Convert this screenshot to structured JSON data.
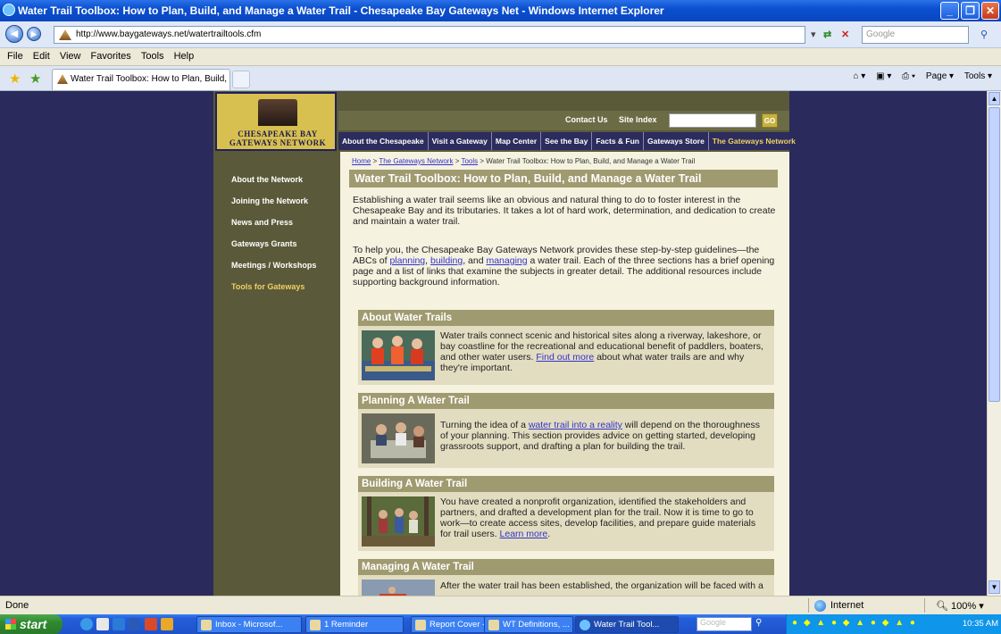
{
  "window": {
    "title": "Water Trail Toolbox: How to Plan, Build, and Manage a Water Trail - Chesapeake Bay Gateways Net - Windows Internet Explorer",
    "min": "_",
    "max": "❐",
    "close": "✕"
  },
  "address_bar": {
    "url": "http://www.baygateways.net/watertrailtools.cfm",
    "search_placeholder": "Google"
  },
  "menu": [
    "File",
    "Edit",
    "View",
    "Favorites",
    "Tools",
    "Help"
  ],
  "tab": {
    "label": "Water Trail Toolbox: How to Plan, Build, a..."
  },
  "command_bar": [
    "Page ▾",
    "Tools ▾"
  ],
  "site": {
    "logo_line1": "CHESAPEAKE BAY",
    "logo_line2": "GATEWAYS NETWORK",
    "top_links": [
      "Contact Us",
      "Site Index"
    ],
    "go_label": "GO",
    "nav": [
      "About the Chesapeake",
      "Visit a Gateway",
      "Map Center",
      "See the Bay",
      "Facts & Fun",
      "Gateways Store",
      "The Gateways Network"
    ],
    "sidebar": [
      "About the Network",
      "Joining the Network",
      "News and Press",
      "Gateways Grants",
      "Meetings / Workshops",
      "Tools for Gateways"
    ],
    "breadcrumb": {
      "home": "Home",
      "sep1": " > ",
      "network": "The Gateways Network",
      "sep2": " > ",
      "tools": "Tools",
      "current": " > Water Trail Toolbox: How to Plan, Build, and Manage a Water Trail"
    },
    "page_title": "Water Trail Toolbox: How to Plan, Build, and Manage a Water Trail",
    "intro1": "Establishing a water trail seems like an obvious and natural thing to do to foster interest in the Chesapeake Bay and its tributaries. It takes a lot of hard work, determination, and dedication to create and maintain a water trail.",
    "intro2_a": "To help you, the Chesapeake Bay Gateways Network provides these step-by-step guidelines—the ABCs of ",
    "intro2_planning": "planning",
    "intro2_comma": ", ",
    "intro2_building": "building",
    "intro2_and": ", and ",
    "intro2_managing": "managing",
    "intro2_b": " a water trail. Each of the three sections has a brief opening page and a list of links that examine the subjects in greater detail. The additional resources include supporting background information.",
    "sections": [
      {
        "title": "About Water Trails",
        "text_a": "Water trails connect scenic and historical sites along a riverway, lakeshore, or bay coastline for the recreational and educational benefit of paddlers, boaters, and other water users. ",
        "link": "Find out more",
        "text_b": " about what water trails are and why they're important."
      },
      {
        "title": "Planning A Water Trail",
        "text_a": "Turning the idea of a ",
        "link": "water trail into a reality",
        "text_b": " will depend on the thoroughness of your planning. This section provides advice on getting started, developing grassroots support, and drafting a plan for building the trail."
      },
      {
        "title": "Building A Water Trail",
        "text_a": "You have created a nonprofit organization, identified the stakeholders and partners, and drafted a development plan for the trail. Now it is time to go to work—to create access sites, develop facilities, and prepare guide materials for trail users. ",
        "link": "Learn more",
        "text_b": "."
      },
      {
        "title": "Managing A Water Trail",
        "text_a": "After the water trail has been established, the organization will be faced with a",
        "link": "",
        "text_b": ""
      }
    ]
  },
  "status": {
    "text": "Done",
    "zone": "Internet",
    "zoom": "100%"
  },
  "taskbar": {
    "start": "start",
    "tasks": [
      "Inbox - Microsof...",
      "1 Reminder",
      "Report Cover - ...",
      "WT Definitions, ...",
      "Water Trail Tool..."
    ],
    "search_placeholder": "Google",
    "clock": "10:35 AM"
  },
  "colors": {
    "page_bg": "#2b2a5c",
    "sidebar_bg": "#5a5a3a",
    "content_bg": "#f5f2df",
    "header_bar": "#a09a70",
    "nav_bg": "#2c2c5e",
    "active_link": "#f0d060"
  }
}
